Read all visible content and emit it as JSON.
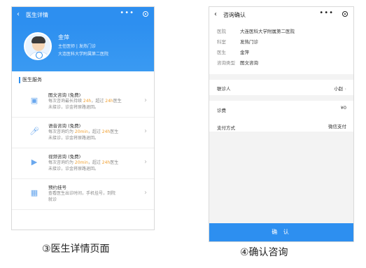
{
  "detail": {
    "title": "医生详情",
    "doctor": {
      "name": "金萍",
      "meta": "主任医师 | 发热门诊",
      "hospital": "大连医科大学附属第二医院"
    },
    "section_title": "医生服务",
    "services": [
      {
        "icon": "image-icon",
        "name": "图文咨询 (免费)",
        "desc": "每次咨询最长持续 24h，超过 24h医生\n未接诊，诊金将原路退回。"
      },
      {
        "icon": "microphone-icon",
        "name": "语音咨询 (免费)",
        "desc": "每次咨询约为 20min，超过 24h医生\n未接诊，诊金将原路退回。"
      },
      {
        "icon": "video-icon",
        "name": "视频咨询 (免费)",
        "desc": "每次咨询约为 20min，超过 24h医生\n未接诊，诊金将原路退回。"
      },
      {
        "icon": "calendar-icon",
        "name": "预约挂号",
        "desc": "查看医生出诊时间，手机挂号，到院\n就诊"
      }
    ]
  },
  "confirm": {
    "title": "咨询确认",
    "info": [
      {
        "k": "医院",
        "v": "大连医科大学附属第二医院"
      },
      {
        "k": "科室",
        "v": "发热门诊"
      },
      {
        "k": "医生",
        "v": "金萍"
      },
      {
        "k": "咨询类型",
        "v": "图文咨询"
      }
    ],
    "consultant_label": "联诊人",
    "consultant_value": "小赵",
    "fee_label": "诊费",
    "fee_value": "¥0",
    "pay_label": "支付方式",
    "pay_value": "微信支付",
    "button": "确 认"
  },
  "captions": {
    "left": "③医生详情页面",
    "right": "④确认咨询"
  }
}
